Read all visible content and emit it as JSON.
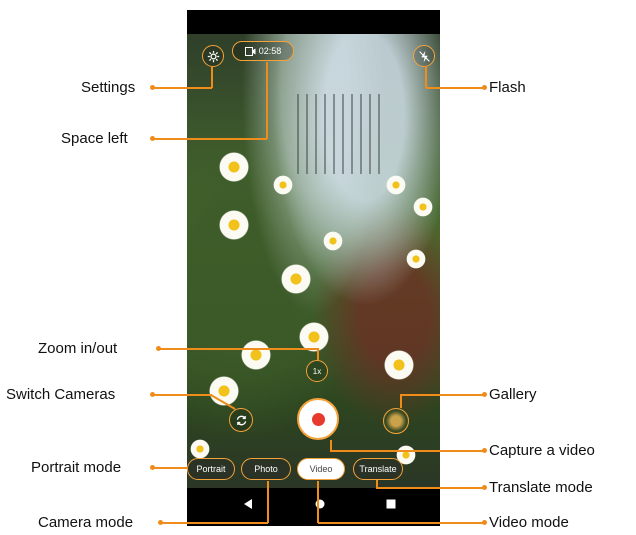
{
  "annotations": {
    "settings": "Settings",
    "space_left": "Space left",
    "flash": "Flash",
    "zoom": "Zoom in/out",
    "switch_cameras": "Switch Cameras",
    "gallery": "Gallery",
    "capture_video": "Capture a video",
    "portrait_mode": "Portrait mode",
    "translate_mode": "Translate mode",
    "camera_mode": "Camera mode",
    "video_mode": "Video mode"
  },
  "camera": {
    "space_left_value": "02:58",
    "zoom_label": "1x",
    "modes": {
      "portrait": "Portrait",
      "photo": "Photo",
      "video": "Video",
      "translate": "Translate"
    },
    "active_mode": "Video"
  },
  "colors": {
    "accent": "#f08c1a",
    "record": "#e8392e"
  },
  "icons": [
    "gear-icon",
    "video-storage-icon",
    "flash-off-icon",
    "zoom-icon",
    "switch-camera-icon",
    "gallery-thumbnail",
    "back-icon",
    "home-icon",
    "recents-icon"
  ]
}
